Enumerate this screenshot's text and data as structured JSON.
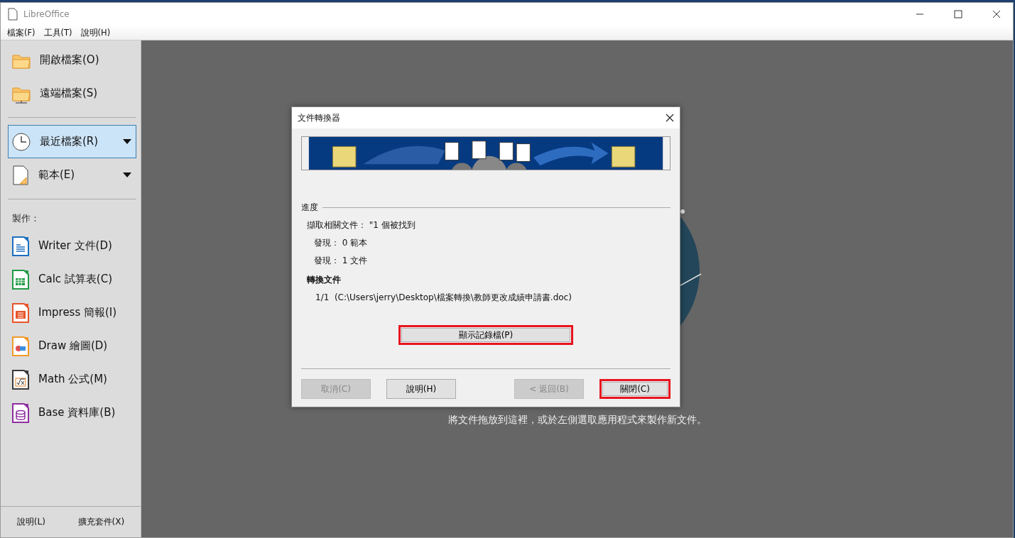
{
  "window": {
    "title": "LibreOffice"
  },
  "menu": [
    "檔案(F)",
    "工具(T)",
    "說明(H)"
  ],
  "sidebar": {
    "file_actions": [
      {
        "label": "開啟檔案(O)",
        "kind": "open"
      },
      {
        "label": "遠端檔案(S)",
        "kind": "remote"
      }
    ],
    "lists": [
      {
        "label": "最近檔案(R)",
        "kind": "recent",
        "selected": true
      },
      {
        "label": "範本(E)",
        "kind": "templates",
        "selected": false
      }
    ],
    "create_heading": "製作：",
    "apps": [
      {
        "label": "Writer 文件(D)",
        "kind": "writer",
        "color": "#1c6fc0"
      },
      {
        "label": "Calc 試算表(C)",
        "kind": "calc",
        "color": "#1f9a45"
      },
      {
        "label": "Impress 簡報(I)",
        "kind": "impress",
        "color": "#e8542a"
      },
      {
        "label": "Draw 繪圖(D)",
        "kind": "draw",
        "color": "#f09a2a"
      },
      {
        "label": "Math 公式(M)",
        "kind": "math",
        "color": "#3a3a3a"
      },
      {
        "label": "Base 資料庫(B)",
        "kind": "base",
        "color": "#8e2ea0"
      }
    ],
    "footer": [
      "說明(L)",
      "擴充套件(X)"
    ]
  },
  "welcome": {
    "hint": "將文件拖放到這裡，或於左側選取應用程式來製作新文件。"
  },
  "dialog": {
    "title": "文件轉換器",
    "progress_heading": "進度",
    "progress_lines": [
      {
        "text": "擷取相關文件： \"1 個被找到",
        "kind": "summary"
      },
      {
        "text": "發現： 0 範本",
        "kind": "detail"
      },
      {
        "text": "發現： 1 文件",
        "kind": "detail"
      }
    ],
    "converted_heading": "轉換文件",
    "converted_file": "1/1  (C:\\Users\\jerry\\Desktop\\檔案轉換\\教師更改成績申請書.doc)",
    "show_log": {
      "label": "顯示記錄檔(P)",
      "highlighted": true
    },
    "buttons": [
      {
        "label": "取消(C)",
        "disabled": true,
        "highlighted": false
      },
      {
        "label": "說明(H)",
        "disabled": false,
        "highlighted": false
      },
      {
        "label": "< 返回(B)",
        "disabled": true,
        "highlighted": false
      },
      {
        "label": "關閉(C)",
        "disabled": false,
        "highlighted": true
      }
    ]
  }
}
